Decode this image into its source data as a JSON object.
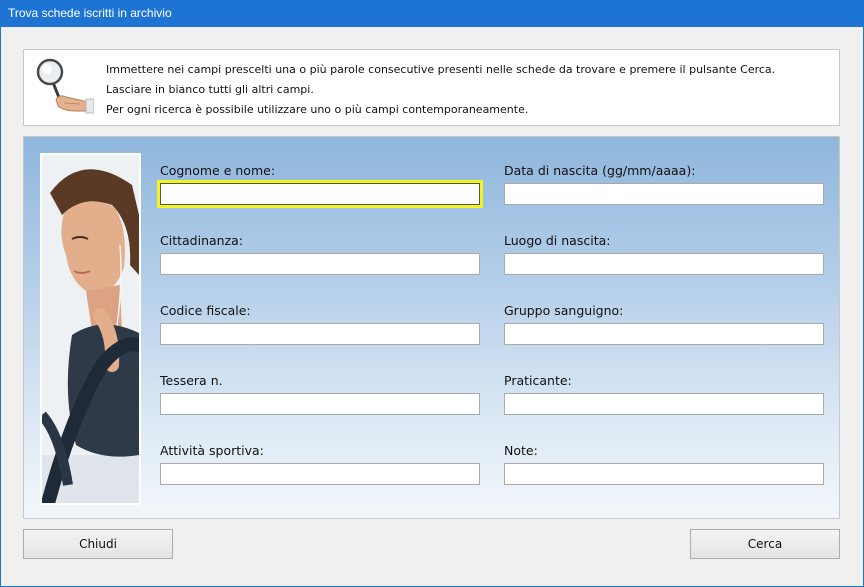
{
  "window": {
    "title": "Trova schede iscritti in archivio"
  },
  "instructions": {
    "line1": "Immettere nei campi prescelti una o più parole consecutive presenti nelle schede da trovare e premere il pulsante Cerca.",
    "line2": "Lasciare in bianco tutti gli altri campi.",
    "line3": "Per ogni ricerca è possibile utilizzare uno o più campi contemporaneamente."
  },
  "fields": {
    "cognome_nome": {
      "label": "Cognome e nome:",
      "value": ""
    },
    "data_nascita": {
      "label": "Data di nascita (gg/mm/aaaa):",
      "value": ""
    },
    "cittadinanza": {
      "label": "Cittadinanza:",
      "value": ""
    },
    "luogo_nascita": {
      "label": "Luogo di nascita:",
      "value": ""
    },
    "codice_fiscale": {
      "label": "Codice fiscale:",
      "value": ""
    },
    "gruppo_sanguigno": {
      "label": "Gruppo sanguigno:",
      "value": ""
    },
    "tessera": {
      "label": "Tessera n.",
      "value": ""
    },
    "praticante": {
      "label": "Praticante:",
      "value": ""
    },
    "attivita_sportiva": {
      "label": "Attività sportiva:",
      "value": ""
    },
    "note": {
      "label": "Note:",
      "value": ""
    }
  },
  "buttons": {
    "close": "Chiudi",
    "search": "Cerca"
  },
  "colors": {
    "titlebar": "#1e74d2",
    "focus_highlight": "#f5f51e"
  },
  "icons": {
    "search": "magnifier-hand-icon"
  }
}
